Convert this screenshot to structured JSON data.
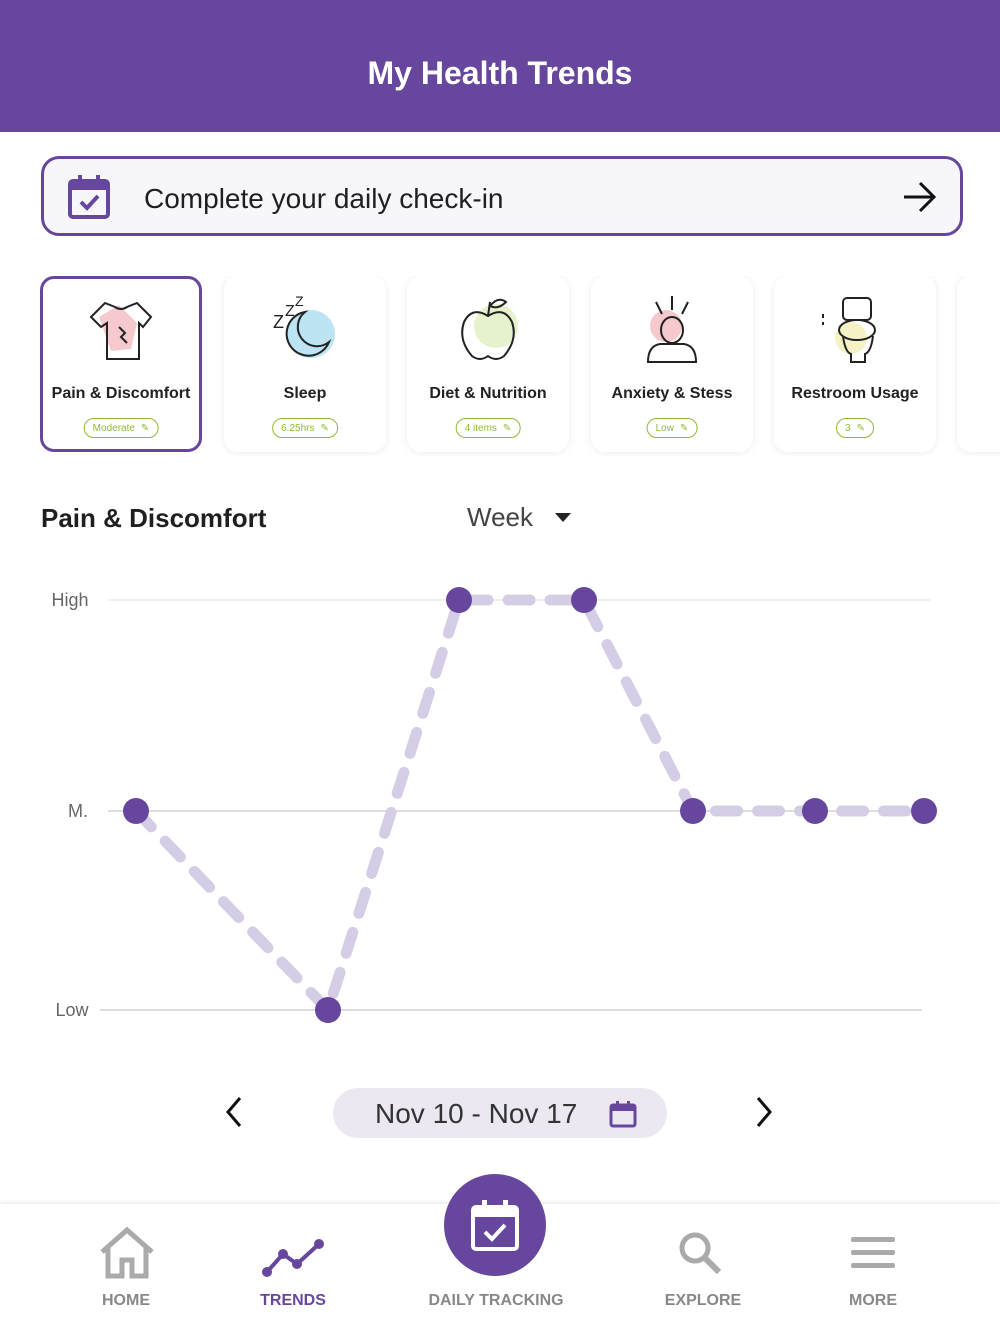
{
  "header": {
    "title": "My Health Trends"
  },
  "checkin": {
    "label": "Complete your daily check-in"
  },
  "cards": [
    {
      "title": "Pain & Discomfort",
      "value": "Moderate",
      "icon": "shirt-pain-icon"
    },
    {
      "title": "Sleep",
      "value": "6.25hrs",
      "icon": "moon-zzz-icon"
    },
    {
      "title": "Diet & Nutrition",
      "value": "4 items",
      "icon": "apple-icon"
    },
    {
      "title": "Anxiety & Stess",
      "value": "Low",
      "icon": "stressed-face-icon"
    },
    {
      "title": "Restroom Usage",
      "value": "3",
      "icon": "toilet-icon"
    }
  ],
  "section": {
    "title": "Pain & Discomfort",
    "period": "Week"
  },
  "chart_data": {
    "type": "line",
    "y_levels": [
      "Low",
      "M.",
      "High"
    ],
    "y_tick_labels": [
      "High",
      "M.",
      "Low"
    ],
    "values": [
      1,
      0,
      2,
      2,
      1,
      1,
      1
    ],
    "style": "dashed",
    "color": "#67479d",
    "line_color": "#d5cde6"
  },
  "pager": {
    "range": "Nov 10 - Nov 17"
  },
  "tabs": [
    {
      "label": "HOME",
      "icon": "home-icon"
    },
    {
      "label": "TRENDS",
      "icon": "trends-icon"
    },
    {
      "label": "DAILY TRACKING",
      "icon": "calendar-check-icon"
    },
    {
      "label": "EXPLORE",
      "icon": "search-icon"
    },
    {
      "label": "MORE",
      "icon": "menu-icon"
    }
  ],
  "colors": {
    "brand": "#67479d",
    "accent_green": "#8dbb33"
  }
}
